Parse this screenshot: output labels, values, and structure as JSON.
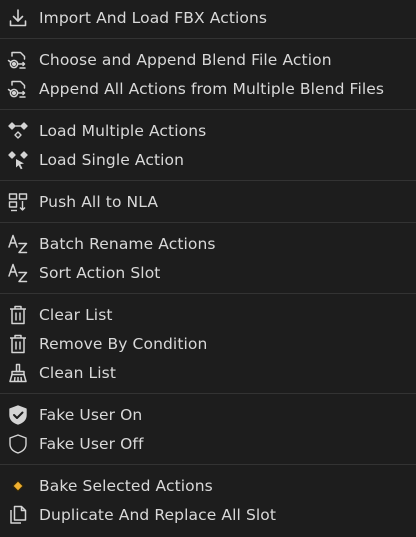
{
  "menu": {
    "groups": [
      {
        "items": [
          {
            "label": "Import And Load FBX Actions",
            "icon": "import-icon"
          }
        ]
      },
      {
        "items": [
          {
            "label": "Choose and Append Blend File Action",
            "icon": "append-blend-icon"
          },
          {
            "label": "Append All Actions from Multiple Blend Files",
            "icon": "append-blend-icon"
          }
        ]
      },
      {
        "items": [
          {
            "label": "Load Multiple Actions",
            "icon": "keyframes-icon"
          },
          {
            "label": "Load Single Action",
            "icon": "keyframe-cursor-icon"
          }
        ]
      },
      {
        "items": [
          {
            "label": "Push All to NLA",
            "icon": "nla-push-icon"
          }
        ]
      },
      {
        "items": [
          {
            "label": "Batch Rename Actions",
            "icon": "sort-alpha-icon"
          },
          {
            "label": "Sort Action Slot",
            "icon": "sort-alpha-icon"
          }
        ]
      },
      {
        "items": [
          {
            "label": "Clear List",
            "icon": "trash-icon"
          },
          {
            "label": "Remove By Condition",
            "icon": "trash-icon"
          },
          {
            "label": "Clean List",
            "icon": "brush-icon"
          }
        ]
      },
      {
        "items": [
          {
            "label": "Fake User On",
            "icon": "shield-filled-icon"
          },
          {
            "label": "Fake User Off",
            "icon": "shield-outline-icon"
          }
        ]
      },
      {
        "items": [
          {
            "label": "Bake Selected Actions",
            "icon": "keyframe-diamond-icon"
          },
          {
            "label": "Duplicate And Replace All Slot",
            "icon": "duplicate-icon"
          }
        ]
      }
    ],
    "accent_color": "#f0b030"
  }
}
